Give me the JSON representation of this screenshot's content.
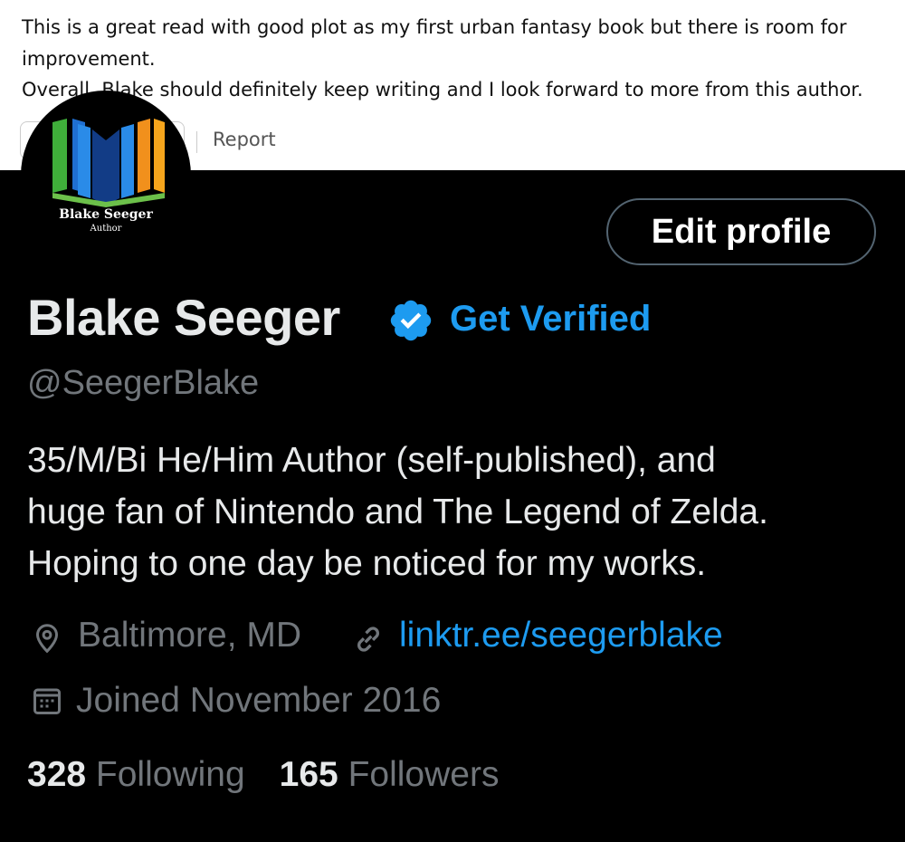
{
  "review": {
    "lines": [
      "This is a great read with good plot as my first urban fantasy book but there is room for",
      "improvement.",
      "Overall, Blake should definitely keep writing and I look forward to more from this author."
    ],
    "report_label": "Report"
  },
  "profile": {
    "avatar": {
      "title": "Blake Seeger",
      "subtitle": "Author"
    },
    "edit_label": "Edit profile",
    "name": "Blake Seeger",
    "verified_icon": "verified-badge-icon",
    "get_verified": "Get Verified",
    "handle": "@SeegerBlake",
    "bio": [
      "35/M/Bi He/Him Author (self-published), and",
      "huge fan of Nintendo and The Legend of Zelda.",
      "Hoping to one day be noticed for my works."
    ],
    "location": "Baltimore, MD",
    "link": "linktr.ee/seegerblake",
    "joined": "Joined November 2016",
    "following_count": "328",
    "following_label": "Following",
    "followers_count": "165",
    "followers_label": "Followers"
  },
  "colors": {
    "background": "#000000",
    "text_primary": "#e7e9ea",
    "text_secondary": "#71767b",
    "accent": "#1d9bf0"
  }
}
